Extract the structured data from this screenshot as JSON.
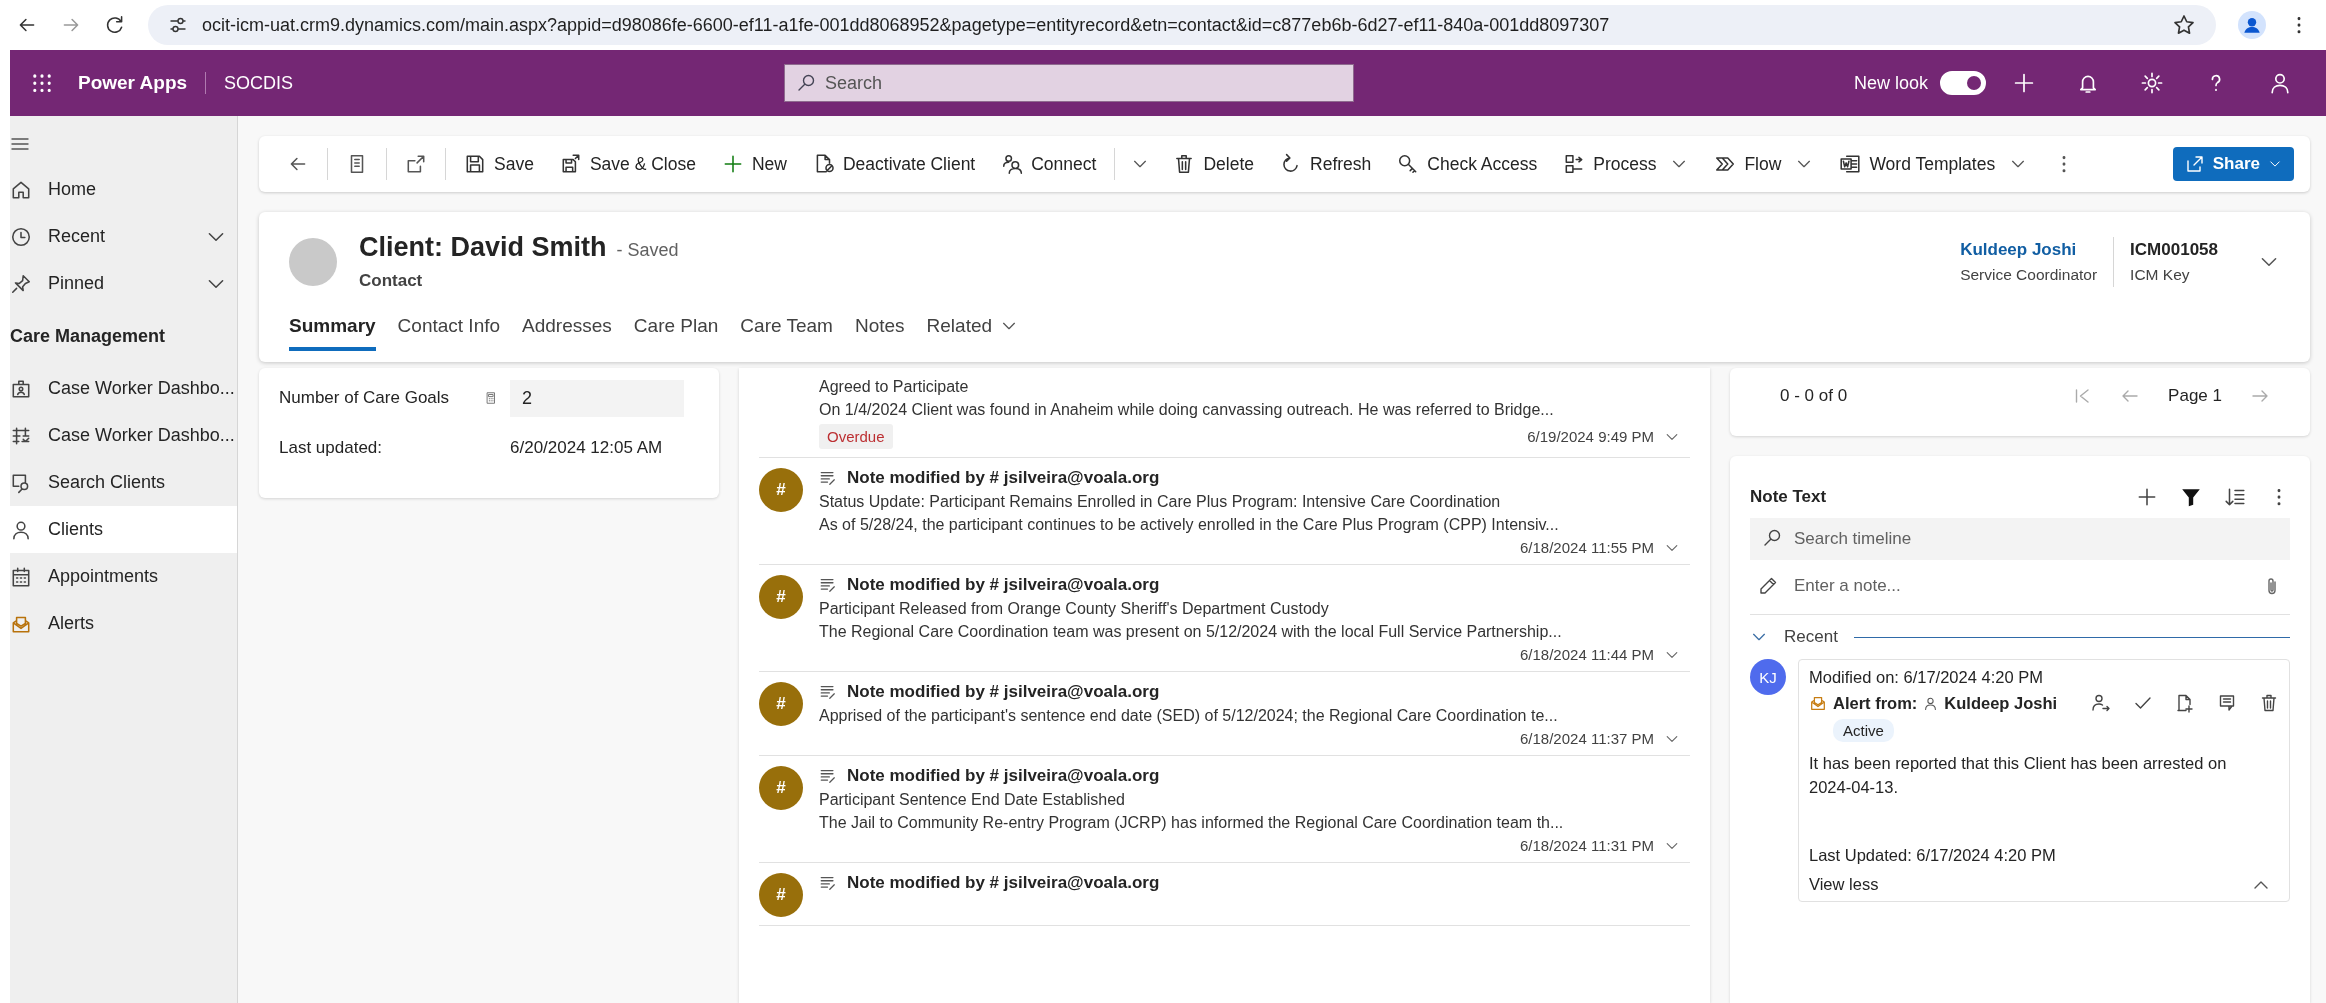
{
  "browser": {
    "url": "ocit-icm-uat.crm9.dynamics.com/main.aspx?appid=d98086fe-6600-ef11-a1fe-001dd8068952&pagetype=entityrecord&etn=contact&id=c877eb6b-6d27-ef11-840a-001dd8097307"
  },
  "app_bar": {
    "app_name": "Power Apps",
    "environment": "SOCDIS",
    "search_placeholder": "Search",
    "new_look": {
      "label": "New look",
      "on": true
    }
  },
  "sidebar": {
    "items": [
      {
        "label": "Home",
        "expandable": false,
        "selected": false
      },
      {
        "label": "Recent",
        "expandable": true,
        "selected": false
      },
      {
        "label": "Pinned",
        "expandable": true,
        "selected": false
      }
    ],
    "section": {
      "title": "Care Management",
      "items": [
        {
          "label": "Case Worker Dashbo...",
          "selected": false
        },
        {
          "label": "Case Worker Dashbo...",
          "selected": false
        },
        {
          "label": "Search Clients",
          "selected": false
        },
        {
          "label": "Clients",
          "selected": true
        },
        {
          "label": "Appointments",
          "selected": false
        },
        {
          "label": "Alerts",
          "selected": false
        }
      ]
    }
  },
  "command_bar": {
    "commands": [
      {
        "label": "Save",
        "kind": "button"
      },
      {
        "label": "Save & Close",
        "kind": "button"
      },
      {
        "label": "New",
        "kind": "button"
      },
      {
        "label": "Deactivate Client",
        "kind": "button"
      },
      {
        "label": "Connect",
        "kind": "split"
      },
      {
        "label": "Delete",
        "kind": "button"
      },
      {
        "label": "Refresh",
        "kind": "button"
      },
      {
        "label": "Check Access",
        "kind": "button"
      },
      {
        "label": "Process",
        "kind": "menu"
      },
      {
        "label": "Flow",
        "kind": "menu"
      },
      {
        "label": "Word Templates",
        "kind": "menu"
      }
    ],
    "share": "Share"
  },
  "record_header": {
    "title": "Client: David Smith",
    "save_status": "- Saved",
    "entity": "Contact",
    "owner": {
      "name": "Kuldeep Joshi",
      "role": "Service Coordinator"
    },
    "key": {
      "value": "ICM001058",
      "label": "ICM Key"
    },
    "tabs": [
      {
        "label": "Summary",
        "selected": true,
        "menu": false
      },
      {
        "label": "Contact Info",
        "selected": false,
        "menu": false
      },
      {
        "label": "Addresses",
        "selected": false,
        "menu": false
      },
      {
        "label": "Care Plan",
        "selected": false,
        "menu": false
      },
      {
        "label": "Care Team",
        "selected": false,
        "menu": false
      },
      {
        "label": "Notes",
        "selected": false,
        "menu": false
      },
      {
        "label": "Related",
        "selected": false,
        "menu": true
      }
    ]
  },
  "summary_card": {
    "fields": [
      {
        "label": "Number of Care Goals",
        "value": "2",
        "kind": "calculated"
      },
      {
        "label": "Last updated:",
        "value": "6/20/2024 12:05 AM",
        "kind": "text"
      }
    ]
  },
  "timeline": {
    "items": [
      {
        "subject": "Agreed to Participate",
        "body": "On 1/4/2024 Client was found in Anaheim while doing canvassing outreach. He was referred to Bridge...",
        "tag": "Overdue",
        "date": "6/19/2024 9:49 PM"
      },
      {
        "avatar": "#",
        "title": "Note modified by # jsilveira@voala.org",
        "subject": "Status Update: Participant Remains Enrolled in Care Plus Program: Intensive Care Coordination",
        "body": "As of 5/28/24, the participant continues to be actively enrolled in the Care Plus Program (CPP) Intensiv...",
        "date": "6/18/2024 11:55 PM"
      },
      {
        "avatar": "#",
        "title": "Note modified by # jsilveira@voala.org",
        "subject": "Participant Released from Orange County Sheriff's Department Custody",
        "body": "The Regional Care Coordination team was present on 5/12/2024 with the local Full Service Partnership...",
        "date": "6/18/2024 11:44 PM"
      },
      {
        "avatar": "#",
        "title": "Note modified by # jsilveira@voala.org",
        "body": "Apprised of the participant's sentence end date (SED) of 5/12/2024; the Regional Care Coordination te...",
        "date": "6/18/2024 11:37 PM"
      },
      {
        "avatar": "#",
        "title": "Note modified by # jsilveira@voala.org",
        "subject": "Participant Sentence End Date Established",
        "body": "The Jail to Community Re-entry Program (JCRP) has informed the Regional Care Coordination team th...",
        "date": "6/18/2024 11:31 PM"
      },
      {
        "avatar": "#",
        "title": "Note modified by # jsilveira@voala.org"
      }
    ]
  },
  "pager": {
    "range": "0 - 0 of 0",
    "page": "Page 1"
  },
  "notes_panel": {
    "title": "Note Text",
    "search_placeholder": "Search timeline",
    "note_placeholder": "Enter a note...",
    "group": "Recent",
    "entry": {
      "initials": "KJ",
      "modified": "Modified on: 6/17/2024 4:20 PM",
      "alert_label": "Alert from:",
      "author": "Kuldeep Joshi",
      "status": "Active",
      "body": "It has been reported that this Client has been arrested on 2024-04-13.",
      "last_updated": "Last Updated: 6/17/2024 4:20 PM",
      "toggle": "View less"
    }
  }
}
